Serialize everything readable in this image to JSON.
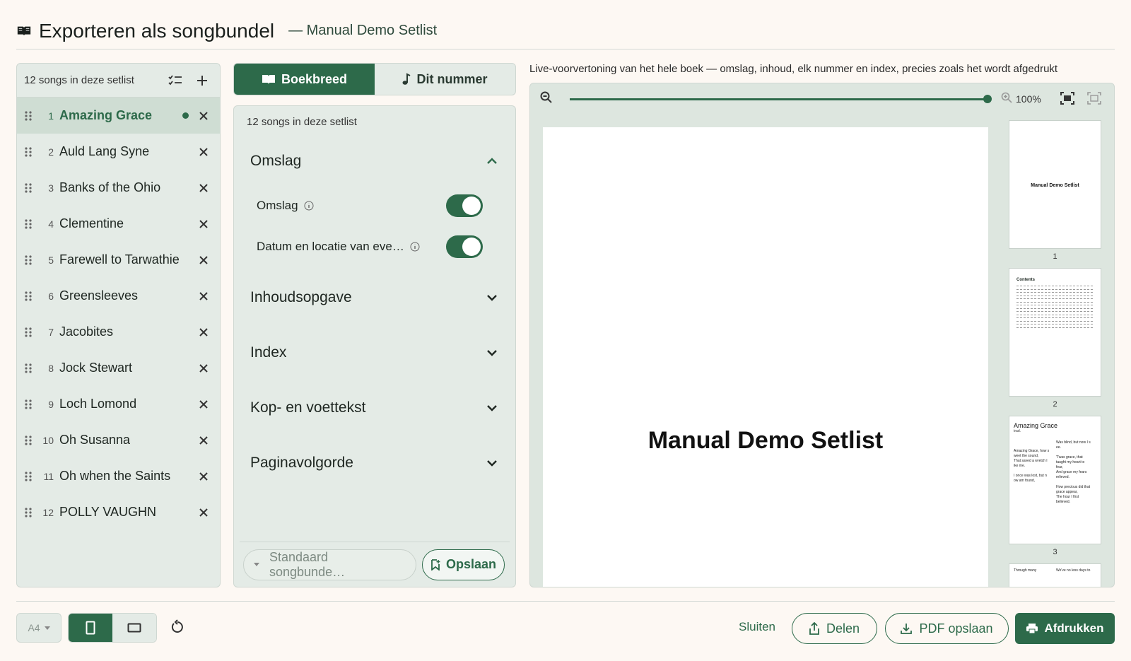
{
  "header": {
    "title": "Exporteren als songbundel",
    "subtitle": "— Manual Demo Setlist"
  },
  "songlist": {
    "count_label": "12 songs in deze setlist",
    "songs": [
      {
        "num": "1",
        "name": "Amazing Grace"
      },
      {
        "num": "2",
        "name": "Auld Lang Syne"
      },
      {
        "num": "3",
        "name": "Banks of the Ohio"
      },
      {
        "num": "4",
        "name": "Clementine"
      },
      {
        "num": "5",
        "name": "Farewell to Tarwathie"
      },
      {
        "num": "6",
        "name": "Greensleeves"
      },
      {
        "num": "7",
        "name": "Jacobites"
      },
      {
        "num": "8",
        "name": "Jock Stewart"
      },
      {
        "num": "9",
        "name": "Loch Lomond"
      },
      {
        "num": "10",
        "name": "Oh Susanna"
      },
      {
        "num": "11",
        "name": "Oh when the Saints"
      },
      {
        "num": "12",
        "name": "POLLY VAUGHN"
      }
    ]
  },
  "tabs": {
    "book": "Boekbreed",
    "song": "Dit nummer"
  },
  "settings": {
    "count_label": "12 songs in deze setlist",
    "sections": {
      "cover": "Omslag",
      "toc": "Inhoudsopgave",
      "index": "Index",
      "header_footer": "Kop- en voettekst",
      "page_order": "Paginavolgorde"
    },
    "toggles": {
      "cover": "Omslag",
      "date_location": "Datum en locatie van eve…"
    },
    "preset_placeholder": "Standaard songbunde…",
    "save_label": "Opslaan"
  },
  "preview": {
    "caption": "Live-voorvertoning van het hele boek — omslag, inhoud, elk nummer en index, precies zoals het wordt afgedrukt",
    "zoom": "100%",
    "zoom_level": 1.0,
    "page_title": "Manual Demo Setlist",
    "thumbs": {
      "t1_title": "Manual Demo Setlist",
      "n1": "1",
      "t2_title": "Contents",
      "n2": "2",
      "t3_title": "Amazing Grace",
      "t3_sub": "trad.",
      "t3_left": "Amazing Grace, how s\nweet the sound,\nThat saved a wretch l\nike me.\n\nI once was lost, but n\now am found,",
      "t3_right": "Was blind, but now I s\nee.\n\n'Twas grace, that\ntaught my heart to\nfear,\nAnd grace my fears\nrelieved.\n\nHow precious did that\ngrace appear,\nThe hour I first\nbelieved.",
      "n3": "3",
      "t4_left": "Through many",
      "t4_right": "We've no less days to"
    }
  },
  "bottom": {
    "paper": "A4",
    "close": "Sluiten",
    "share": "Delen",
    "save_pdf": "PDF opslaan",
    "print": "Afdrukken"
  },
  "colors": {
    "accent": "#2d6a4a",
    "panel": "#e4ebe6",
    "background": "#fdf8f3"
  }
}
